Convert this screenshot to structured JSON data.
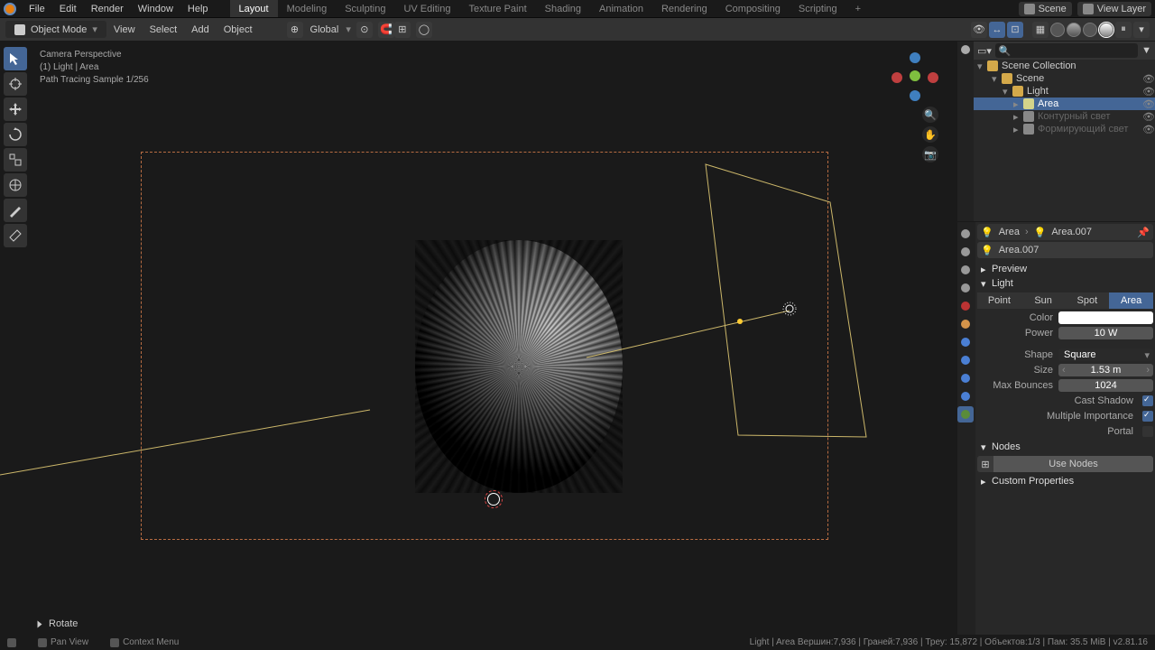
{
  "top_menu": [
    "File",
    "Edit",
    "Render",
    "Window",
    "Help"
  ],
  "workspace_tabs": [
    "Layout",
    "Modeling",
    "Sculpting",
    "UV Editing",
    "Texture Paint",
    "Shading",
    "Animation",
    "Rendering",
    "Compositing",
    "Scripting"
  ],
  "active_tab": "Layout",
  "scene": "Scene",
  "view_layer": "View Layer",
  "header": {
    "mode": "Object Mode",
    "menus": [
      "View",
      "Select",
      "Add",
      "Object"
    ],
    "orientation": "Global"
  },
  "overlay": {
    "line1": "Camera Perspective",
    "line2": "(1) Light | Area",
    "line3": "Path Tracing Sample 1/256"
  },
  "last_operator": "Rotate",
  "outliner": {
    "root": "Scene Collection",
    "items": [
      {
        "indent": 1,
        "label": "Scene",
        "expanded": true
      },
      {
        "indent": 2,
        "label": "Light",
        "expanded": true
      },
      {
        "indent": 3,
        "label": "Area",
        "selected": true
      },
      {
        "indent": 3,
        "label": "Контурный свет",
        "dimmed": true
      },
      {
        "indent": 3,
        "label": "Формирующий свет",
        "dimmed": true
      }
    ]
  },
  "breadcrumb": {
    "obj": "Area",
    "data": "Area.007"
  },
  "data_name": "Area.007",
  "panels": {
    "preview": "Preview",
    "light": "Light",
    "nodes": "Nodes",
    "custom": "Custom Properties"
  },
  "light_types": [
    "Point",
    "Sun",
    "Spot",
    "Area"
  ],
  "active_light_type": "Area",
  "light_props": {
    "color_label": "Color",
    "power_label": "Power",
    "power_value": "10 W",
    "shape_label": "Shape",
    "shape_value": "Square",
    "size_label": "Size",
    "size_value": "1.53 m",
    "bounces_label": "Max Bounces",
    "bounces_value": "1024",
    "cast_shadow_label": "Cast Shadow",
    "cast_shadow": true,
    "multi_importance_label": "Multiple Importance",
    "multi_importance": true,
    "portal_label": "Portal",
    "portal": false
  },
  "use_nodes": "Use Nodes",
  "status_bar": {
    "left": [
      "Pan View",
      "Context Menu"
    ],
    "right": "Light | Area     Вершин:7,936  |  Граней:7,936  |  Треу: 15,872  |  Объектов:1/3  |  Пам: 35.5 MiB  |  v2.81.16"
  }
}
